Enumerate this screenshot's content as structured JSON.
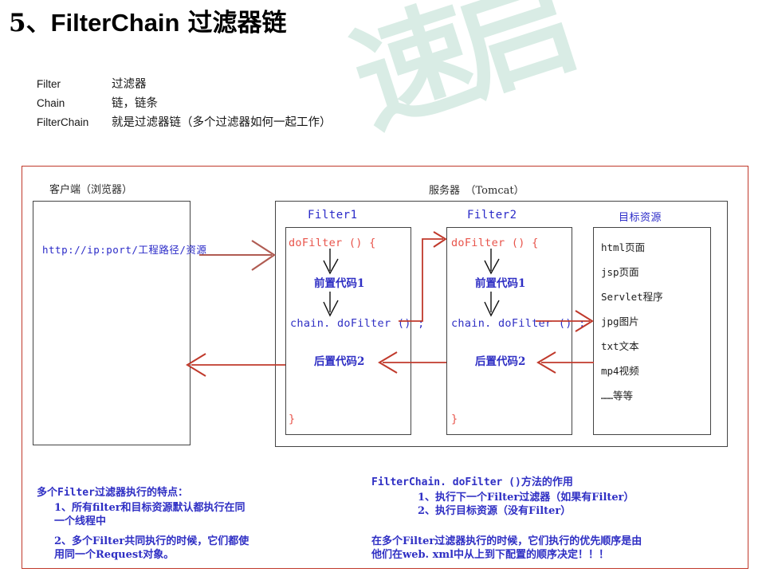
{
  "slide": {
    "title_number": "5、",
    "title_en": "FilterChain",
    "title_cn": "过滤器链",
    "watermark_text": "速启"
  },
  "glossary": [
    {
      "term": "Filter",
      "definition": "过滤器"
    },
    {
      "term": "Chain",
      "definition": "链，链条"
    },
    {
      "term": "FilterChain",
      "definition": "就是过滤器链（多个过滤器如何一起工作）"
    }
  ],
  "diagram": {
    "client_label": "客户端（浏览器）",
    "server_label": "服务器　（Tomcat）",
    "request_url": "http://ip:port/工程路径/资源",
    "filters": [
      {
        "title": "Filter1",
        "open": "doFilter () {",
        "pre_code": "前置代码1",
        "chain_call": "chain. doFilter () ;",
        "post_code": "后置代码2",
        "close": "}"
      },
      {
        "title": "Filter2",
        "open": "doFilter ()  {",
        "pre_code": "前置代码1",
        "chain_call": "chain. doFilter () ;",
        "post_code": "后置代码2",
        "close": "}"
      }
    ],
    "target": {
      "title": "目标资源",
      "items": [
        "html页面",
        "jsp页面",
        "Servlet程序",
        "jpg图片",
        "txt文本",
        "mp4视频",
        "……等等"
      ]
    }
  },
  "notes": {
    "left": {
      "heading": "多个Filter过滤器执行的特点：",
      "items": [
        "1、所有filter和目标资源默认都执行在同\n一个线程中",
        "2、多个Filter共同执行的时候，它们都使\n用同一个Request对象。"
      ]
    },
    "right": {
      "heading": "FilterChain. doFilter ()方法的作用",
      "items": [
        "1、执行下一个Filter过滤器（如果有Filter）",
        "2、执行目标资源（没有Filter）"
      ],
      "footer": "在多个Filter过滤器执行的时候，它们执行的优先顺序是由\n他们在web. xml中从上到下配置的顺序决定！！！"
    }
  },
  "colors": {
    "frame_red": "#c0392b",
    "code_red": "#e8534a",
    "code_blue": "#2f2fc4",
    "arrow_red": "#9b3b34",
    "watermark_green": "#d8ece4"
  }
}
